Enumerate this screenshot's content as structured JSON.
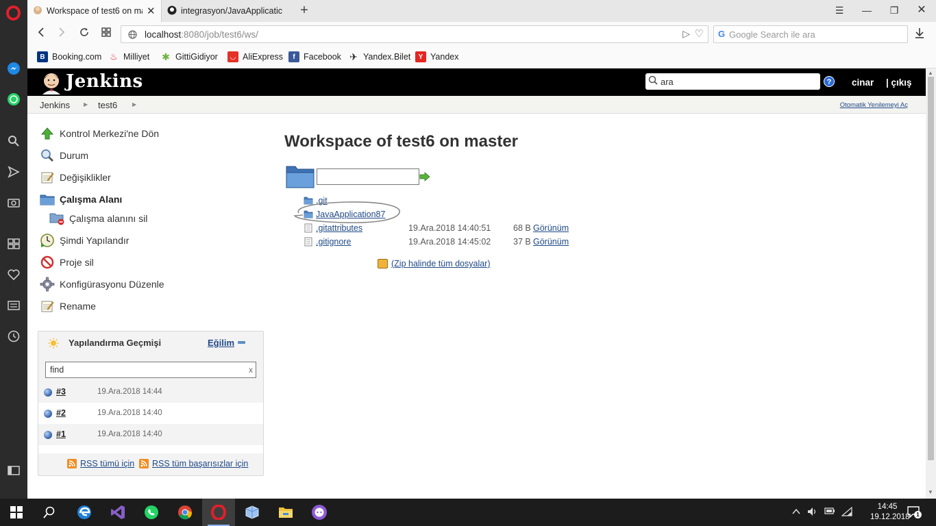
{
  "browser": {
    "tabs": [
      {
        "title": "Workspace of test6 on ma",
        "active": true
      },
      {
        "title": "integrasyon/JavaApplicatic",
        "active": false
      }
    ],
    "url_host": "localhost",
    "url_rest": ":8080/job/test6/ws/",
    "search_placeholder": "Google Search ile ara",
    "bookmarks": [
      {
        "label": "Booking.com",
        "icon": "booking-icon",
        "color": "#003580"
      },
      {
        "label": "Milliyet",
        "icon": "milliyet-icon",
        "color": "#e3262d"
      },
      {
        "label": "GittiGidiyor",
        "icon": "gittigidiyor-icon",
        "color": "#6cb33f"
      },
      {
        "label": "AliExpress",
        "icon": "aliexpress-icon",
        "color": "#e43225"
      },
      {
        "label": "Facebook",
        "icon": "facebook-icon",
        "color": "#3b5998"
      },
      {
        "label": "Yandex.Bilet",
        "icon": "plane-icon",
        "color": "#222222"
      },
      {
        "label": "Yandex",
        "icon": "yandex-icon",
        "color": "#e52620"
      }
    ]
  },
  "jenkins": {
    "logo": "Jenkins",
    "search_value": "ara",
    "help": "?",
    "user": "cinar",
    "logout": "| çıkış",
    "breadcrumb": [
      "Jenkins",
      "test6"
    ],
    "auto_refresh": "Otomatik Yenilemeyi Aç",
    "tasks": [
      {
        "label": "Kontrol Merkezi'ne Dön",
        "icon": "up-arrow-icon"
      },
      {
        "label": "Durum",
        "icon": "magnifier-icon"
      },
      {
        "label": "Değişiklikler",
        "icon": "notepad-icon"
      },
      {
        "label": "Çalışma Alanı",
        "icon": "folder-icon"
      },
      {
        "label": "Çalışma alanını sil",
        "icon": "folder-delete-icon"
      },
      {
        "label": "Şimdi Yapılandır",
        "icon": "clock-build-icon"
      },
      {
        "label": "Proje sil",
        "icon": "no-entry-icon"
      },
      {
        "label": "Konfigürasyonu Düzenle",
        "icon": "gear-icon"
      },
      {
        "label": "Rename",
        "icon": "notepad-icon"
      }
    ],
    "build_history": {
      "title": "Yapılandırma Geçmişi",
      "trend": "Eğilim",
      "filter": "find",
      "filter_clear": "x",
      "builds": [
        {
          "number": "#3",
          "date": "19.Ara.2018 14:44"
        },
        {
          "number": "#2",
          "date": "19.Ara.2018 14:40"
        },
        {
          "number": "#1",
          "date": "19.Ara.2018 14:40"
        }
      ],
      "rss_all": "RSS tümü için",
      "rss_failures": "RSS tüm başarısızlar için"
    },
    "workspace": {
      "title": "Workspace of test6 on master",
      "files": [
        {
          "name": ".git",
          "type": "folder",
          "date": "",
          "size": "",
          "view": ""
        },
        {
          "name": "JavaApplication87",
          "type": "folder",
          "date": "",
          "size": "",
          "view": ""
        },
        {
          "name": ".gitattributes",
          "type": "file",
          "date": "19.Ara.2018 14:40:51",
          "size": "68 B",
          "view": "Görünüm"
        },
        {
          "name": ".gitignore",
          "type": "file",
          "date": "19.Ara.2018 14:45:02",
          "size": "37 B",
          "view": "Görünüm"
        }
      ],
      "zip": "(Zip halinde tüm dosyalar)"
    }
  },
  "taskbar": {
    "time": "14:45",
    "date": "19.12.2018",
    "notifications": "1",
    "apps": [
      "start-icon",
      "search-icon",
      "edge-icon",
      "visual-studio-icon",
      "whatsapp-icon",
      "chrome-icon",
      "opera-icon",
      "box-app-icon",
      "file-explorer-icon",
      "github-desktop-icon"
    ]
  }
}
